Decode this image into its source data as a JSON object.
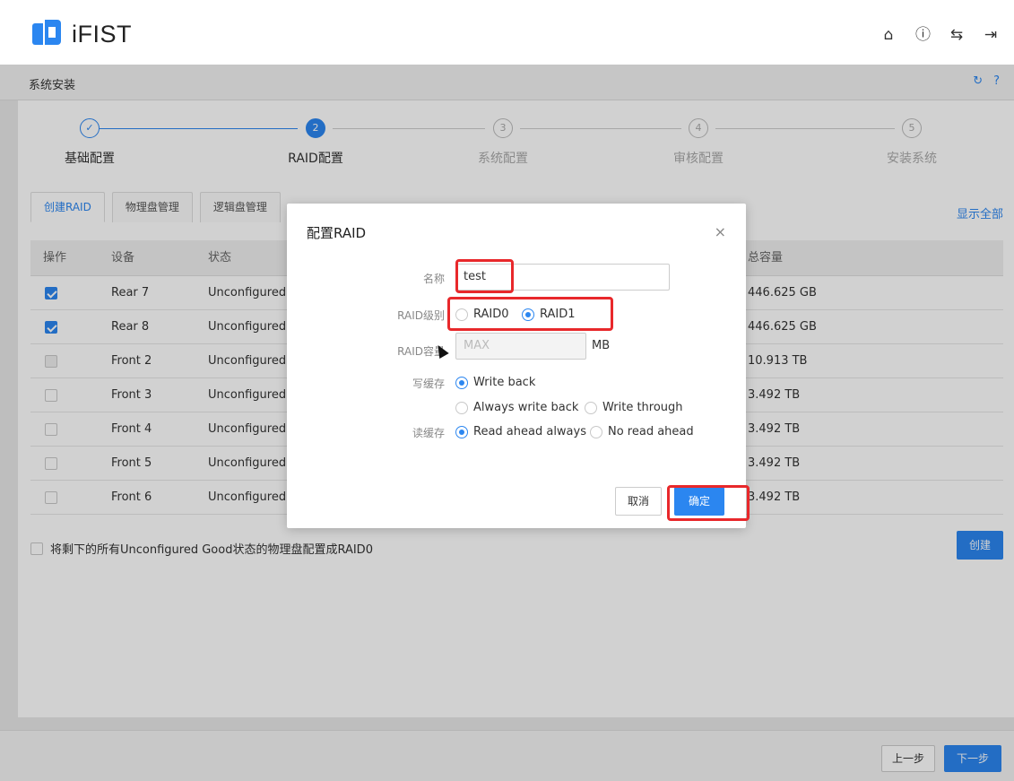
{
  "header": {
    "brand": "iFIST",
    "icons": [
      "home-icon",
      "info-icon",
      "language-icon",
      "logout-icon"
    ]
  },
  "breadcrumb": {
    "title": "系统安装",
    "icons": [
      "refresh-icon",
      "help-icon"
    ]
  },
  "steps": [
    {
      "num": "✓",
      "label": "基础配置",
      "state": "done"
    },
    {
      "num": "2",
      "label": "RAID配置",
      "state": "active"
    },
    {
      "num": "3",
      "label": "系统配置",
      "state": "pending"
    },
    {
      "num": "4",
      "label": "审核配置",
      "state": "pending"
    },
    {
      "num": "5",
      "label": "安装系统",
      "state": "pending"
    }
  ],
  "tabs": [
    {
      "label": "创建RAID",
      "active": true
    },
    {
      "label": "物理盘管理",
      "active": false
    },
    {
      "label": "逻辑盘管理",
      "active": false
    }
  ],
  "show_all": "显示全部",
  "table": {
    "headers": [
      "操作",
      "设备",
      "状态",
      "总容量"
    ],
    "rows": [
      {
        "checked": true,
        "device": "Rear 7",
        "status": "Unconfigured",
        "capacity": "446.625 GB"
      },
      {
        "checked": true,
        "device": "Rear 8",
        "status": "Unconfigured",
        "capacity": "446.625 GB"
      },
      {
        "checked": false,
        "disabled": true,
        "device": "Front 2",
        "status": "Unconfigured",
        "capacity": "10.913 TB"
      },
      {
        "checked": false,
        "device": "Front 3",
        "status": "Unconfigured",
        "capacity": "3.492 TB"
      },
      {
        "checked": false,
        "device": "Front 4",
        "status": "Unconfigured",
        "capacity": "3.492 TB"
      },
      {
        "checked": false,
        "device": "Front 5",
        "status": "Unconfigured",
        "capacity": "3.492 TB"
      },
      {
        "checked": false,
        "device": "Front 6",
        "status": "Unconfigured",
        "capacity": "3.492 TB"
      }
    ]
  },
  "bulk_label": "将剩下的所有Unconfigured Good状态的物理盘配置成RAID0",
  "create_button": "创建",
  "footer": {
    "prev": "上一步",
    "next": "下一步"
  },
  "modal": {
    "title": "配置RAID",
    "close": "×",
    "name_label": "名称",
    "name_value": "test",
    "level_label": "RAID级别",
    "level_options": [
      "RAID0",
      "RAID1"
    ],
    "level_selected": "RAID1",
    "capacity_label": "RAID容量",
    "capacity_placeholder": "MAX",
    "capacity_unit": "MB",
    "write_cache_label": "写缓存",
    "write_options": [
      "Write back",
      "Always write back",
      "Write through"
    ],
    "write_selected": "Write back",
    "read_cache_label": "读缓存",
    "read_options": [
      "Read ahead always",
      "No read ahead"
    ],
    "read_selected": "Read ahead always",
    "cancel": "取消",
    "ok": "确定"
  },
  "colors": {
    "accent": "#2b86f0",
    "highlight": "#e8282b"
  }
}
